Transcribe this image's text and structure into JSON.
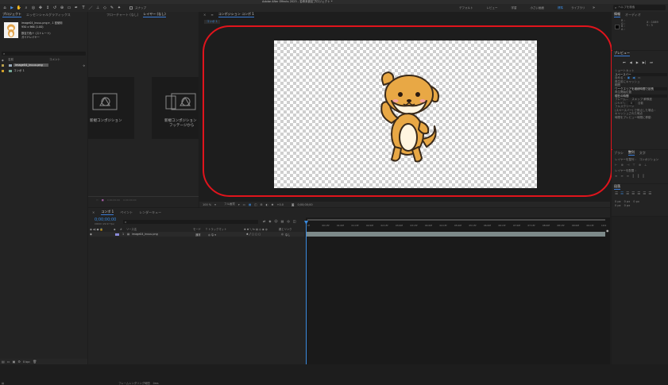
{
  "app_title": "Adobe After Effects 2023 - 名称未設定プロジェクト *",
  "workspaces": [
    "デフォルト",
    "レビュー",
    "学習",
    "小さい画面",
    "標準",
    "ライブラリ"
  ],
  "active_workspace": "標準",
  "search_help": "ヘルプを検索",
  "toolbar": {
    "snap_label": "スナップ"
  },
  "project_panel": {
    "tabs": [
      "プロジェクト",
      "エッセンシャルグラフィックス"
    ],
    "item_info_name": "image04_inuuu.png ▾ , 1 回使用",
    "item_info_size": "950 x 966 (1.00)",
    "item_info_color": "数百万色＋ (ストレート)",
    "item_info_interp": "ガイドレイヤー",
    "search_placeholder": "",
    "col_name": "名前",
    "col_comment": "コメント",
    "items": [
      {
        "name": "image04_inuuu.png",
        "selected": true
      },
      {
        "name": "コンポ 1",
        "selected": false
      }
    ]
  },
  "flowchart_panel": {
    "tabs": [
      "フローチャート (なし)",
      "レイヤー (なし)"
    ],
    "card1_label": "新規コンポジション",
    "card2_line1": "新規コンポジション",
    "card2_line2": "フッテージから"
  },
  "comp_panel": {
    "tab": "コンポジション コンポ 1",
    "breadcrumb": "コンポ 1",
    "zoom": "100 %",
    "resolution": "フル画質",
    "timecode": "0;00;00;00"
  },
  "info_panel": {
    "tabs": [
      "情報",
      "オーディオ"
    ],
    "r": "R :",
    "g": "G :",
    "b": "B :",
    "a": "A :",
    "x": "X : 1089",
    "y": "Y : 3"
  },
  "preview_panel": {
    "title": "プレビュー",
    "shortcut_label": "ショートカット",
    "shortcut_value": "スペースバー",
    "include_label": "含める :",
    "cache_label": "再生前にキャッシュ",
    "range_label": "範囲",
    "range_value": "ワークエリアを継続時間で延長",
    "play_from_label": "再生開始位置",
    "play_from_value": "現在の時間",
    "frame_rate_label": "フレーム...",
    "skip_label": "スキップ 解像度",
    "frame_rate_value": "(29.97)",
    "skip_value": "0",
    "res_value": "自動",
    "fullscreen_label": "フルスクリーン",
    "stop_label": "(スペースバー) で停止した場合 :",
    "cache_frames_label": "キャッシュされた時点",
    "move_time_label": "時間をプレビュー時間に移動"
  },
  "brush_panel": {
    "tabs": [
      "ブラシ",
      "整列",
      "文字"
    ],
    "align_layer_label": "レイヤーを整列 :",
    "align_target": "コンポジション",
    "distribute_label": "レイヤーを配置 :"
  },
  "paragraph_panel": {
    "title": "段落",
    "values": [
      "0 px",
      "0 px",
      "0 px",
      "0 px",
      "0 px"
    ]
  },
  "timeline": {
    "tabs": [
      "コンポ 1",
      "レンダーキュー"
    ],
    "paint_tab": "ペイント",
    "timecode": "0;00;00;00",
    "fps_sub": "00000 (29.97 fps)",
    "col_source": "ソース名",
    "col_mode": "モード",
    "col_trkmat": "T トラックマット",
    "col_parent": "親とリンク",
    "layer_index": "1",
    "layer_name": "image04_inuuu.png",
    "layer_mode": "通常",
    "layer_parent": "なし",
    "ruler_marks": [
      "0f",
      "00:15f",
      "01:00f",
      "01:15f",
      "02:00f",
      "02:15f",
      "03:00f",
      "03:15f",
      "04:00f",
      "04:15f",
      "05:00f",
      "05:15f",
      "06:00f",
      "06:15f",
      "07:00f",
      "07:15f",
      "08:00f",
      "08:15f",
      "09:00f",
      "09:15f",
      "10:0"
    ]
  },
  "status_bar": {
    "render_time_label": "フレームレンダリング時間",
    "render_time_value": "0ms",
    "zoom_value": "8 bpc"
  },
  "colors": {
    "bg": "#1d1d1d",
    "panel": "#232323",
    "accent_blue": "#3a8be0",
    "highlight_red": "#e0141c",
    "layer_bar": "#7d8a8a"
  }
}
